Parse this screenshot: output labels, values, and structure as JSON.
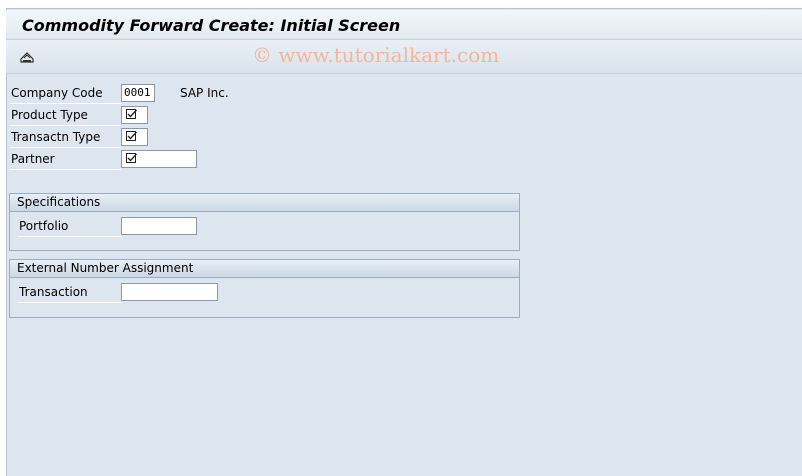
{
  "header": {
    "title": "Commodity Forward Create: Initial Screen",
    "watermark": "© www.tutorialkart.com"
  },
  "toolbar": {
    "items": [
      {
        "icon": "enter-icon"
      }
    ]
  },
  "fields": {
    "company_code": {
      "label": "Company Code",
      "value": "0001",
      "description": "SAP Inc."
    },
    "product_type": {
      "label": "Product Type",
      "value": ""
    },
    "transaction_type": {
      "label": "Transactn Type",
      "value": ""
    },
    "partner": {
      "label": "Partner",
      "value": ""
    }
  },
  "specifications": {
    "title": "Specifications",
    "portfolio": {
      "label": "Portfolio",
      "value": ""
    }
  },
  "external_number": {
    "title": "External Number Assignment",
    "transaction": {
      "label": "Transaction",
      "value": ""
    }
  },
  "colors": {
    "background": "#dde6ef",
    "group_border": "#9aacbe",
    "watermark": "#f2b79a"
  }
}
